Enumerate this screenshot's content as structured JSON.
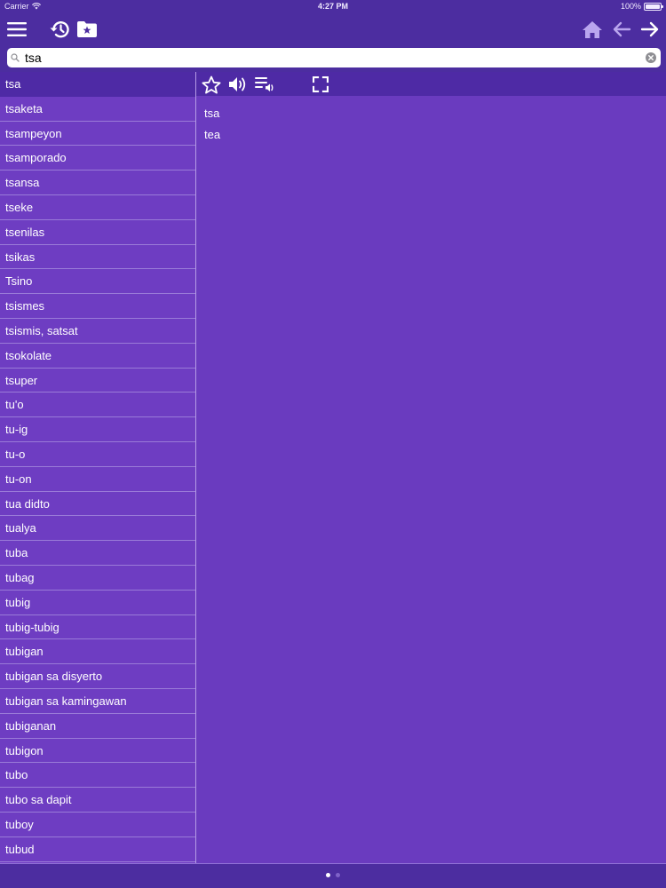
{
  "status_bar": {
    "carrier": "Carrier",
    "time": "4:27 PM",
    "battery": "100%"
  },
  "search": {
    "value": "tsa",
    "placeholder": ""
  },
  "word_list": [
    "tsa",
    "tsaketa",
    "tsampeyon",
    "tsamporado",
    "tsansa",
    "tseke",
    "tsenilas",
    "tsikas",
    "Tsino",
    "tsismes",
    "tsismis, satsat",
    "tsokolate",
    "tsuper",
    "tu'o",
    "tu-ig",
    "tu-o",
    "tu-on",
    "tua didto",
    "tualya",
    "tuba",
    "tubag",
    "tubig",
    "tubig-tubig",
    "tubigan",
    "tubigan sa disyerto",
    "tubigan sa kamingawan",
    "tubiganan",
    "tubigon",
    "tubo",
    "tubo sa dapit",
    "tuboy",
    "tubud"
  ],
  "selected_index": 0,
  "entry": {
    "headword": "tsa",
    "translation": "tea"
  },
  "pager": {
    "pages": 2,
    "current": 0
  },
  "colors": {
    "nav_bg": "#4c2da0",
    "list_bg": "#6e3dc2",
    "detail_bg": "#6a3bbf",
    "selected": "#4e2aa5",
    "icon_dim": "#b9a5ee"
  }
}
